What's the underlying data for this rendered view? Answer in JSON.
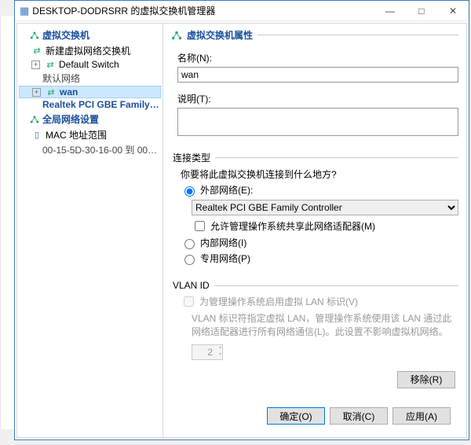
{
  "window": {
    "title": "DESKTOP-DODRSRR 的虚拟交换机管理器",
    "controls": {
      "min": "—",
      "max": "□",
      "close": "✕"
    }
  },
  "left": {
    "section1": "虚拟交换机",
    "new_switch": "新建虚拟网络交换机",
    "default_switch": "Default Switch",
    "default_net": "默认网络",
    "wan": "wan",
    "wan_adapter": "Realtek PCI GBE Family Contr...",
    "section2": "全局网络设置",
    "mac_range": "MAC 地址范围",
    "mac_values": "00-15-5D-30-16-00 到 00-15-5D-3..."
  },
  "props": {
    "header": "虚拟交换机属性",
    "name_label": "名称(N):",
    "name_value": "wan",
    "desc_label": "说明(T):",
    "desc_value": ""
  },
  "conn": {
    "header": "连接类型",
    "prompt": "你要将此虚拟交换机连接到什么地方?",
    "external": "外部网络(E):",
    "adapter": "Realtek PCI GBE Family Controller",
    "allow_mgmt": "允许管理操作系统共享此网络适配器(M)",
    "internal": "内部网络(I)",
    "private": "专用网络(P)"
  },
  "vlan": {
    "header": "VLAN ID",
    "enable": "为管理操作系统启用虚拟 LAN 标识(V)",
    "help": "VLAN 标识符指定虚拟 LAN，管理操作系统使用该 LAN 通过此网络适配器进行所有网络通信(L)。此设置不影响虚拟机网络。",
    "value": "2"
  },
  "buttons": {
    "remove": "移除(R)",
    "ok": "确定(O)",
    "cancel": "取消(C)",
    "apply": "应用(A)"
  }
}
